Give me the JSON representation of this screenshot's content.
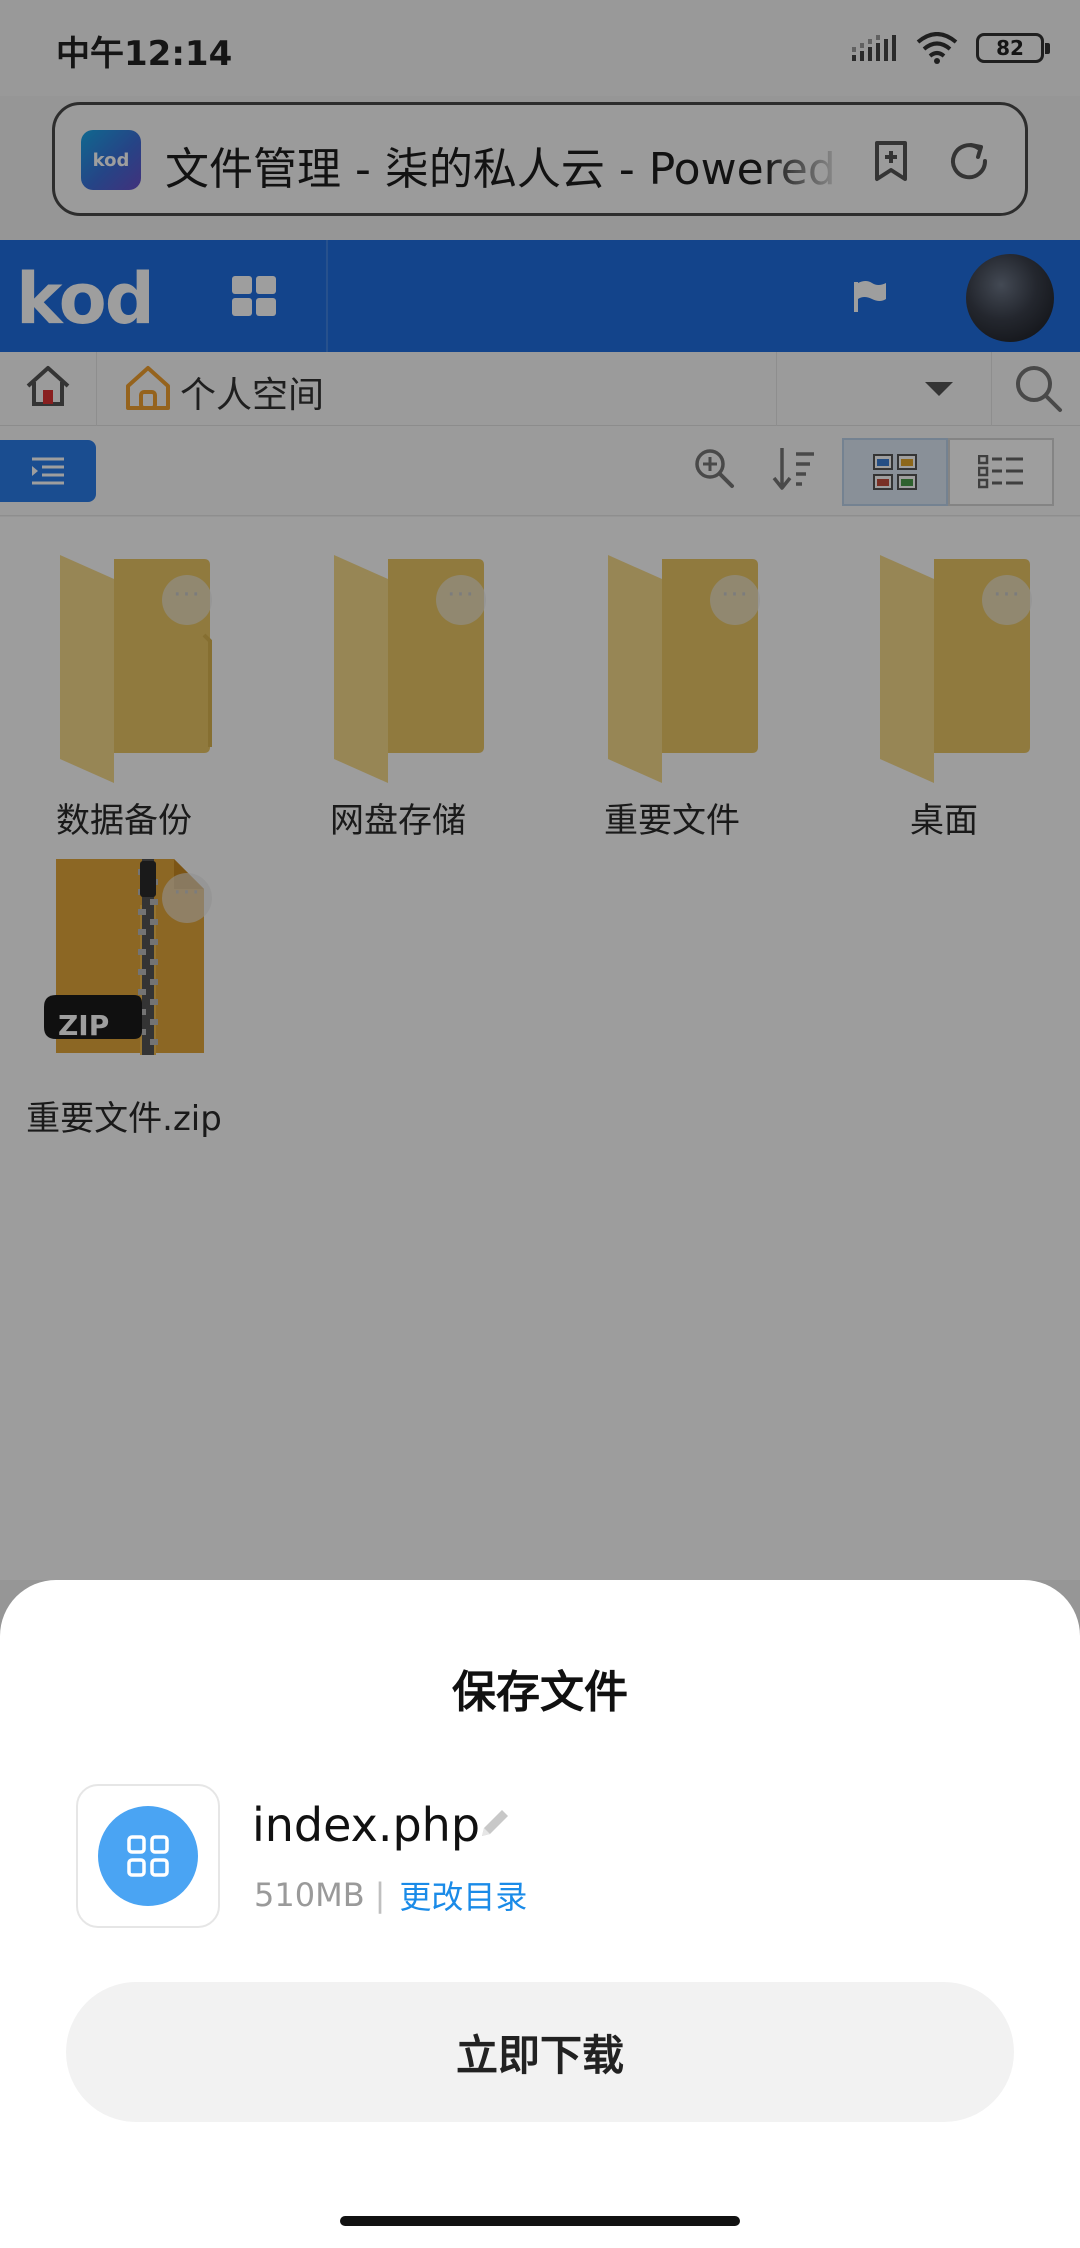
{
  "status_bar": {
    "time": "中午12:14",
    "battery": "82",
    "icons": [
      "signal-icon",
      "wifi-icon",
      "battery-icon"
    ]
  },
  "browser": {
    "favicon_text": "kod",
    "page_title": "文件管理 - 柒的私人云 - Powered by kodbox",
    "icons": [
      "add-bookmark-icon",
      "reload-icon"
    ]
  },
  "app_header": {
    "logo": "kod",
    "icons": [
      "app-grid-icon",
      "flag-icon",
      "avatar"
    ],
    "brand_color": "#1f6ee0"
  },
  "breadcrumb": {
    "current": "个人空间",
    "icons": [
      "home-icon",
      "personal-space-icon",
      "dropdown-icon",
      "search-icon"
    ]
  },
  "toolbar": {
    "icons": [
      "menu-toggle-icon",
      "zoom-icon",
      "sort-icon",
      "grid-view-icon",
      "list-view-icon"
    ],
    "active_view": "grid"
  },
  "files": [
    {
      "name": "数据备份",
      "type": "folder"
    },
    {
      "name": "网盘存储",
      "type": "folder"
    },
    {
      "name": "重要文件",
      "type": "folder"
    },
    {
      "name": "桌面",
      "type": "folder"
    },
    {
      "name": "重要文件.zip",
      "type": "zip",
      "badge": "ZIP"
    }
  ],
  "dialog": {
    "title": "保存文件",
    "file_name": "index.php",
    "file_size": "510MB",
    "separator": "|",
    "change_dir": "更改目录",
    "download_button": "立即下载",
    "accent_color": "#1a8be8"
  }
}
